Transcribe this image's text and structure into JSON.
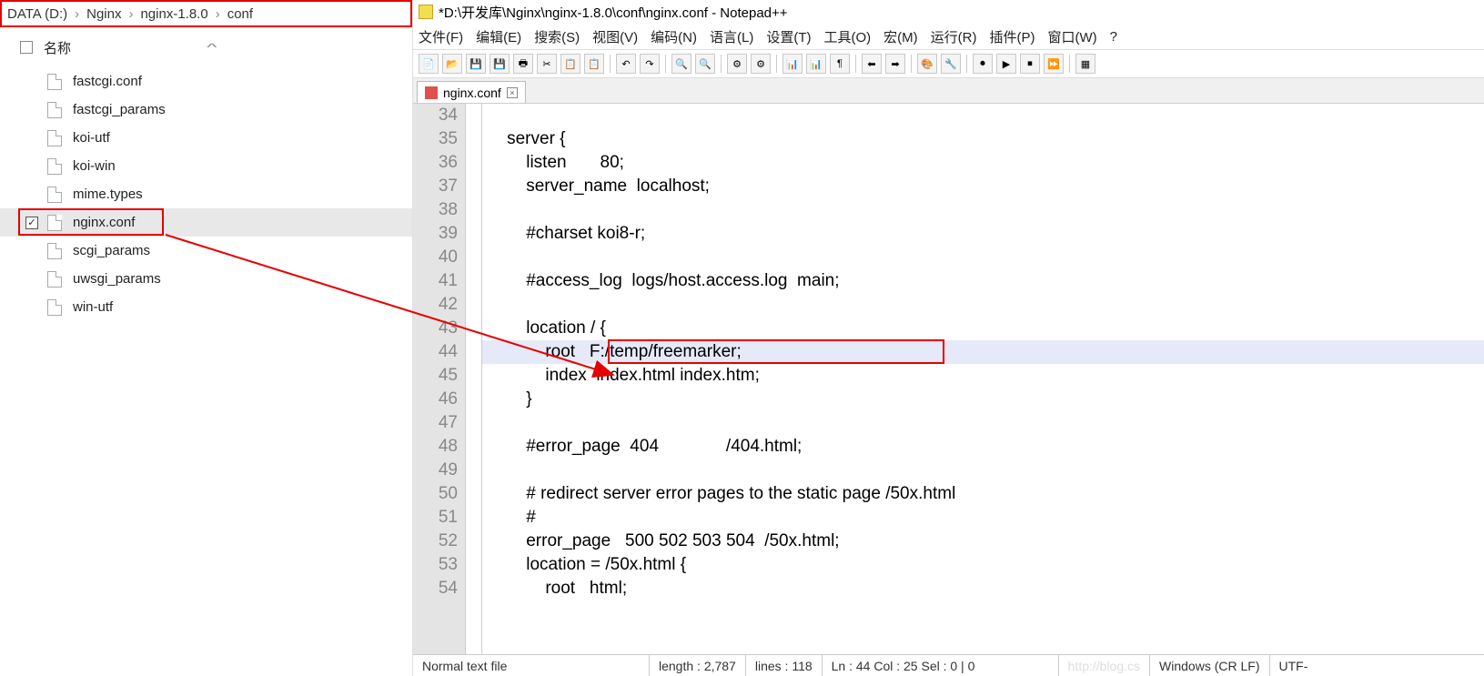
{
  "explorer": {
    "breadcrumb": [
      "DATA (D:)",
      "Nginx",
      "nginx-1.8.0",
      "conf"
    ],
    "header_name": "名称",
    "files": [
      {
        "name": "fastcgi.conf",
        "checked": false
      },
      {
        "name": "fastcgi_params",
        "checked": false
      },
      {
        "name": "koi-utf",
        "checked": false
      },
      {
        "name": "koi-win",
        "checked": false
      },
      {
        "name": "mime.types",
        "checked": false
      },
      {
        "name": "nginx.conf",
        "checked": true,
        "selected": true
      },
      {
        "name": "scgi_params",
        "checked": false
      },
      {
        "name": "uwsgi_params",
        "checked": false
      },
      {
        "name": "win-utf",
        "checked": false
      }
    ]
  },
  "editor": {
    "title": "*D:\\开发库\\Nginx\\nginx-1.8.0\\conf\\nginx.conf - Notepad++",
    "menus": [
      "文件(F)",
      "编辑(E)",
      "搜索(S)",
      "视图(V)",
      "编码(N)",
      "语言(L)",
      "设置(T)",
      "工具(O)",
      "宏(M)",
      "运行(R)",
      "插件(P)",
      "窗口(W)",
      "?"
    ],
    "tab_label": "nginx.conf",
    "first_line_no": 34,
    "lines": [
      "",
      "    server {",
      "        listen       80;",
      "        server_name  localhost;",
      "",
      "        #charset koi8-r;",
      "",
      "        #access_log  logs/host.access.log  main;",
      "",
      "        location / {",
      "            root   F:/temp/freemarker;",
      "            index  index.html index.htm;",
      "        }",
      "",
      "        #error_page  404              /404.html;",
      "",
      "        # redirect server error pages to the static page /50x.html",
      "        #",
      "        error_page   500 502 503 504  /50x.html;",
      "        location = /50x.html {",
      "            root   html;"
    ],
    "highlight_index": 10,
    "status": {
      "mode": "Normal text file",
      "length": "length : 2,787",
      "lines": "lines : 118",
      "pos": "Ln : 44   Col : 25   Sel : 0 | 0",
      "eol": "Windows (CR LF)",
      "enc": "UTF-"
    },
    "watermark": "http://blog.cs"
  }
}
